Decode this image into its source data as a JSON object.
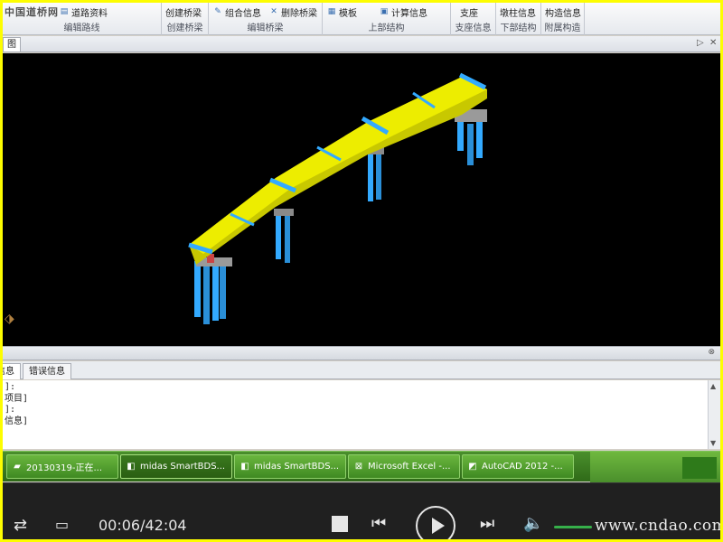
{
  "brand": "中国道桥网",
  "ribbon": {
    "groups": [
      {
        "label": "编辑路线",
        "buttons": [
          "道路资料"
        ]
      },
      {
        "label": "创建桥梁",
        "buttons": [
          "创建桥梁"
        ]
      },
      {
        "label": "编辑桥梁",
        "buttons": [
          "组合信息",
          "删除桥梁"
        ]
      },
      {
        "label": "上部结构",
        "buttons": [
          "模板",
          "计算信息"
        ]
      },
      {
        "label": "支座信息",
        "buttons": [
          "支座"
        ]
      },
      {
        "label": "下部结构",
        "buttons": [
          "墩柱信息"
        ]
      },
      {
        "label": "附属构造",
        "buttons": [
          "构造信息"
        ]
      }
    ]
  },
  "viewport": {
    "tab_label": "图",
    "background": "#000000",
    "deck_color": "#e8e800",
    "pier_color": "#33aaff"
  },
  "output": {
    "tabs": [
      "信息",
      "错误信息"
    ],
    "lines": [
      "]:",
      "项目]",
      "]:",
      "信息]"
    ]
  },
  "taskbar": {
    "items": [
      {
        "label": "20130319-正在...",
        "icon": "folder-icon"
      },
      {
        "label": "midas SmartBDS...",
        "icon": "midas-icon"
      },
      {
        "label": "midas SmartBDS...",
        "icon": "midas-icon"
      },
      {
        "label": "Microsoft Excel -...",
        "icon": "excel-icon"
      },
      {
        "label": "AutoCAD 2012 -...",
        "icon": "autocad-icon"
      }
    ]
  },
  "player": {
    "time": "00:06/42:04",
    "volume": 1.0
  },
  "watermark": "www.cndao.com"
}
